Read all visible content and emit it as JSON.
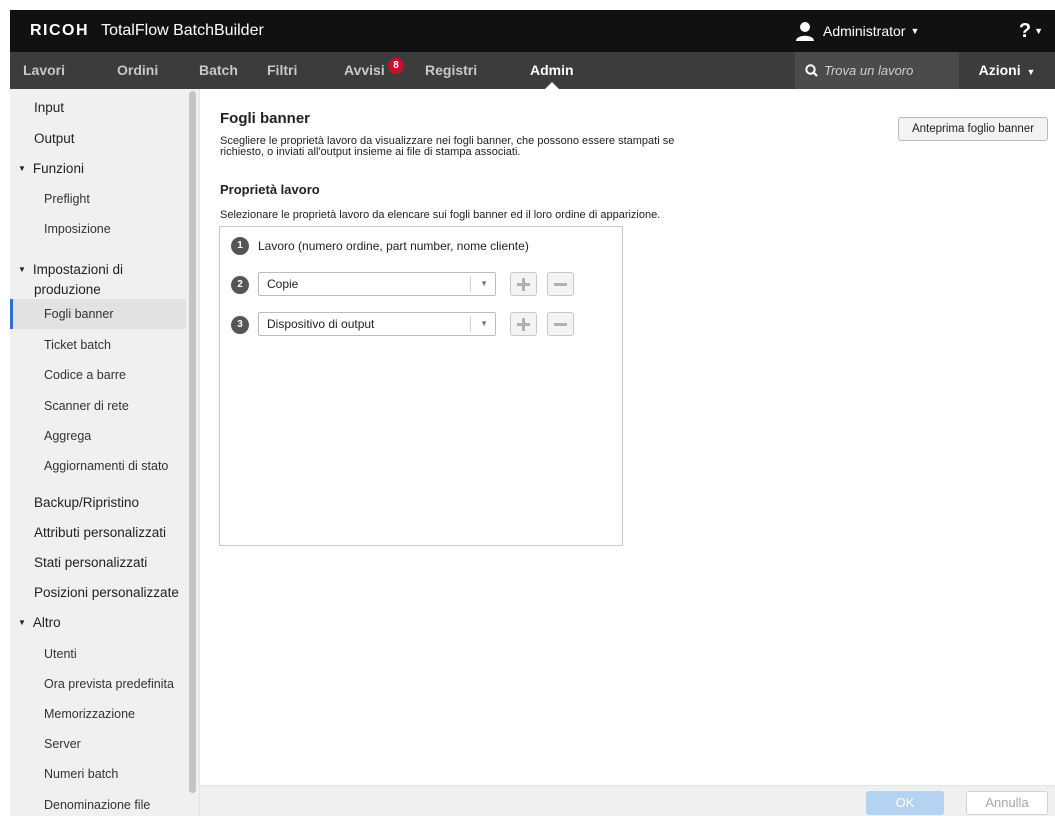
{
  "header": {
    "brand": "RICOH",
    "product": "TotalFlow BatchBuilder",
    "user": "Administrator",
    "help": "?"
  },
  "nav": {
    "tabs": [
      {
        "label": "Lavori"
      },
      {
        "label": "Ordini"
      },
      {
        "label": "Batch"
      },
      {
        "label": "Filtri"
      },
      {
        "label": "Avvisi",
        "badge": "8"
      },
      {
        "label": "Registri"
      },
      {
        "label": "Admin",
        "active": true
      }
    ],
    "search_placeholder": "Trova un lavoro",
    "actions_label": "Azioni"
  },
  "sidebar": {
    "items": [
      {
        "label": "Input"
      },
      {
        "label": "Output"
      },
      {
        "label": "Funzioni",
        "expandable": true
      },
      {
        "label": "Preflight"
      },
      {
        "label": "Imposizione"
      },
      {
        "label": "Impostazioni di produzione",
        "expandable": true
      },
      {
        "label": "Fogli banner",
        "active": true
      },
      {
        "label": "Ticket batch"
      },
      {
        "label": "Codice a barre"
      },
      {
        "label": "Scanner di rete"
      },
      {
        "label": "Aggrega"
      },
      {
        "label": "Aggiornamenti di stato"
      },
      {
        "label": "Backup/Ripristino"
      },
      {
        "label": "Attributi personalizzati"
      },
      {
        "label": "Stati personalizzati"
      },
      {
        "label": "Posizioni personalizzate"
      },
      {
        "label": "Altro",
        "expandable": true
      },
      {
        "label": "Utenti"
      },
      {
        "label": "Ora prevista predefinita"
      },
      {
        "label": "Memorizzazione"
      },
      {
        "label": "Server"
      },
      {
        "label": "Numeri batch"
      },
      {
        "label": "Denominazione file"
      }
    ],
    "production_line1": "Impostazioni di",
    "production_line2": "produzione"
  },
  "main": {
    "title": "Fogli banner",
    "description_line1": "Scegliere le proprietà lavoro da visualizzare nei fogli banner, che possono essere stampati se",
    "description_line2": "richiesto, o inviati all'output insieme ai file di stampa associati.",
    "preview_button": "Anteprima foglio banner",
    "section_title": "Proprietà lavoro",
    "section_description": "Selezionare le proprietà lavoro da elencare sui fogli banner ed il loro ordine di apparizione.",
    "properties": [
      {
        "number": "1",
        "label": "Lavoro (numero ordine, part number, nome cliente)"
      },
      {
        "number": "2",
        "value": "Copie"
      },
      {
        "number": "3",
        "value": "Dispositivo di output"
      }
    ]
  },
  "footer": {
    "ok_label": "OK",
    "cancel_label": "Annulla"
  },
  "colors": {
    "topbar": "#111111",
    "navbar": "#3c3c3c",
    "badge": "#c8102e",
    "active_indicator": "#2f6fcf",
    "ok_disabled": "#b4d3f2"
  }
}
